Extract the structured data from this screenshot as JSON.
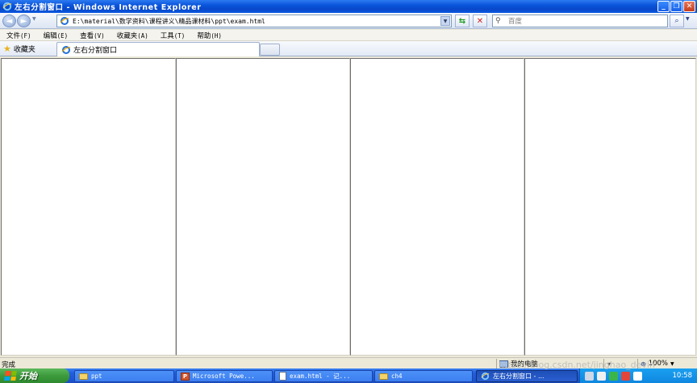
{
  "window": {
    "title": "左右分割窗口 - Windows Internet Explorer"
  },
  "address_bar": {
    "url": "E:\\material\\数学资料\\课程讲义\\精品课材料\\ppt\\exam.html"
  },
  "search": {
    "placeholder": "百度"
  },
  "menu": {
    "items": [
      {
        "label": "文件",
        "key": "(F)"
      },
      {
        "label": "编辑",
        "key": "(E)"
      },
      {
        "label": "查看",
        "key": "(V)"
      },
      {
        "label": "收藏夹",
        "key": "(A)"
      },
      {
        "label": "工具",
        "key": "(T)"
      },
      {
        "label": "帮助",
        "key": "(H)"
      }
    ]
  },
  "favorites": {
    "label": "收藏夹"
  },
  "tab": {
    "label": "左右分割窗口"
  },
  "frames_count": 4,
  "status": {
    "text": "完成",
    "zone": "我的电脑",
    "zoom": "100%"
  },
  "taskbar": {
    "start_label": "开始",
    "tasks": [
      {
        "label": "ppt",
        "icon": "folder-icon"
      },
      {
        "label": "Microsoft Powe...",
        "icon": "powerpoint-icon"
      },
      {
        "label": "exam.html - 记...",
        "icon": "notepad-icon"
      },
      {
        "label": "ch4",
        "icon": "folder-icon"
      },
      {
        "label": "左右分割窗口 - ...",
        "icon": "ie-icon"
      }
    ],
    "clock": "10:58"
  },
  "watermark": "https://blog.csdn.net/jinghao_devin",
  "colors": {
    "titlebar": "#0a55dc",
    "taskbar": "#245edb",
    "start": "#3c9a3c",
    "window_bg": "#ece9d8",
    "frame_bg": "#ffffff"
  }
}
